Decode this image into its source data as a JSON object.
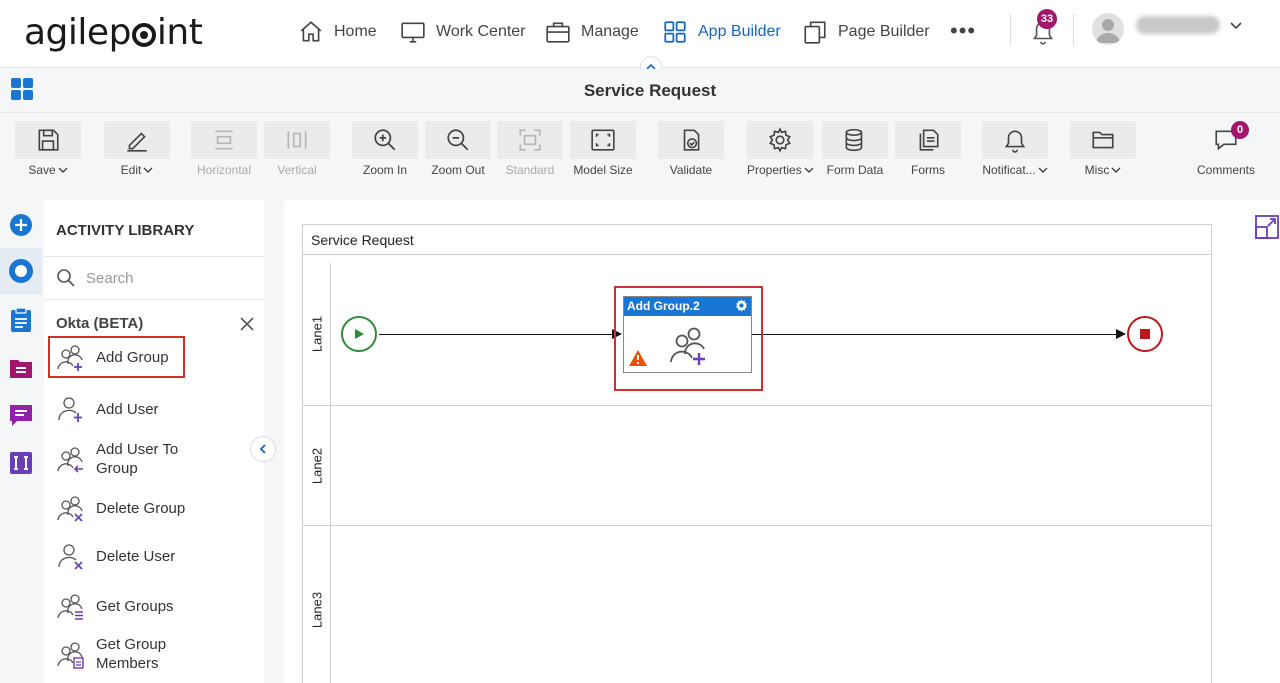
{
  "brand": {
    "logo_text_before": "agilep",
    "logo_text_after": "int"
  },
  "nav": {
    "items": [
      {
        "label": "Home",
        "icon": "home-icon"
      },
      {
        "label": "Work Center",
        "icon": "monitor-icon"
      },
      {
        "label": "Manage",
        "icon": "briefcase-icon"
      },
      {
        "label": "App Builder",
        "icon": "grid-icon",
        "active": true
      },
      {
        "label": "Page Builder",
        "icon": "copy-icon"
      }
    ],
    "more": "•••",
    "notifications_count": "33"
  },
  "title_bar": {
    "title": "Service Request"
  },
  "toolbar": {
    "save": "Save",
    "edit": "Edit",
    "horizontal": "Horizontal",
    "vertical": "Vertical",
    "zoom_in": "Zoom In",
    "zoom_out": "Zoom Out",
    "standard": "Standard",
    "model_size": "Model Size",
    "validate": "Validate",
    "properties": "Properties",
    "form_data": "Form Data",
    "forms": "Forms",
    "notifications": "Notificat...",
    "misc": "Misc",
    "comments": "Comments",
    "comments_count": "0"
  },
  "library": {
    "title": "ACTIVITY LIBRARY",
    "search_placeholder": "Search",
    "category": "Okta (BETA)",
    "items": [
      {
        "label": "Add Group",
        "icon": "add-group-icon",
        "selected": true
      },
      {
        "label": "Add User",
        "icon": "add-user-icon"
      },
      {
        "label": "Add User To Group",
        "icon": "add-user-to-group-icon"
      },
      {
        "label": "Delete Group",
        "icon": "delete-group-icon"
      },
      {
        "label": "Delete User",
        "icon": "delete-user-icon"
      },
      {
        "label": "Get Groups",
        "icon": "get-groups-icon"
      },
      {
        "label": "Get Group Members",
        "icon": "get-group-members-icon"
      }
    ]
  },
  "canvas": {
    "pool_title": "Service Request",
    "lanes": [
      "Lane1",
      "Lane2",
      "Lane3"
    ],
    "task": {
      "title": "Add Group.2",
      "status": "warning"
    }
  },
  "colors": {
    "accent": "#1565c0",
    "task_header": "#1976d2",
    "highlight": "#d32f2f",
    "start_event": "#2e8b3a",
    "end_event": "#b71c1c",
    "badge": "#a0176b",
    "rail_purple": "#8e24aa"
  }
}
